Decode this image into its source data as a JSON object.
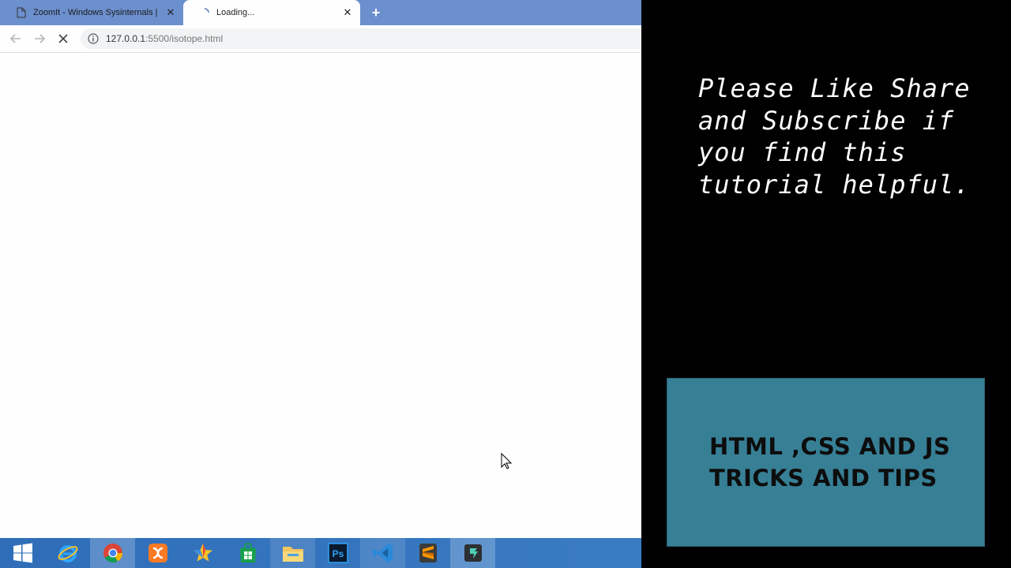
{
  "browser": {
    "tabs": [
      {
        "title": "ZoomIt - Windows Sysinternals |",
        "favicon": "page-icon",
        "active": false
      },
      {
        "title": "Loading...",
        "favicon": "loading-spinner-icon",
        "active": true
      }
    ],
    "new_tab_label": "+",
    "address": {
      "host": "127.0.0.1",
      "path": ":5500/isotope.html"
    }
  },
  "taskbar": {
    "items": [
      {
        "name": "windows-start-icon"
      },
      {
        "name": "internet-explorer-icon"
      },
      {
        "name": "chrome-icon"
      },
      {
        "name": "xampp-icon"
      },
      {
        "name": "app-star-icon"
      },
      {
        "name": "store-icon"
      },
      {
        "name": "file-explorer-icon"
      },
      {
        "name": "photoshop-icon",
        "label": "Ps"
      },
      {
        "name": "vscode-icon"
      },
      {
        "name": "sublime-text-icon"
      },
      {
        "name": "filmora-icon"
      }
    ]
  },
  "panel": {
    "message_lines": [
      "Please Like Share",
      "and Subscribe if",
      "you find this",
      "tutorial helpful."
    ],
    "brand_lines": [
      "HTML ,CSS AND JS",
      "TRICKS AND TIPS"
    ]
  },
  "colors": {
    "tabstrip": "#6c8fce",
    "taskbar": "#2f6db8",
    "brand_box": "#377f95",
    "panel_bg": "#000000"
  }
}
